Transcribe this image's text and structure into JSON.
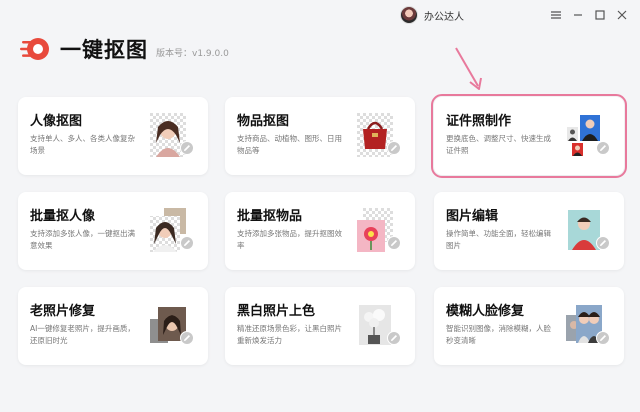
{
  "titlebar": {
    "username": "办公达人"
  },
  "brand": {
    "app_title": "一键抠图",
    "version": "版本号：v1.9.0.0"
  },
  "colors": {
    "accent_red": "#e84a3c",
    "highlight_pink": "#e8799c"
  },
  "cards": [
    {
      "title": "人像抠图",
      "desc": "支持单人、多人、各类人像复杂场景",
      "icon": "portrait-thumbnail"
    },
    {
      "title": "物品抠图",
      "desc": "支持商品、动植物、图形、日用物品等",
      "icon": "handbag-thumbnail"
    },
    {
      "title": "证件照制作",
      "desc": "更换底色、调整尺寸、快速生成证件照",
      "icon": "id-photo-thumbnail"
    },
    {
      "title": "批量抠人像",
      "desc": "支持添加多张人像，一键抠出满意效果",
      "icon": "batch-portrait-thumbnail"
    },
    {
      "title": "批量抠物品",
      "desc": "支持添加多张物品，提升抠图效率",
      "icon": "batch-object-thumbnail"
    },
    {
      "title": "图片编辑",
      "desc": "操作简单、功能全面，轻松编辑图片",
      "icon": "image-edit-thumbnail"
    },
    {
      "title": "老照片修复",
      "desc": "AI一键修复老照片，提升画质，还原旧时光",
      "icon": "old-photo-thumbnail"
    },
    {
      "title": "黑白照片上色",
      "desc": "精准还原场景色彩，让黑白照片重新焕发活力",
      "icon": "colorize-thumbnail"
    },
    {
      "title": "模糊人脸修复",
      "desc": "智能识别图像，消除模糊，人脸秒变清晰",
      "icon": "face-restore-thumbnail"
    }
  ]
}
